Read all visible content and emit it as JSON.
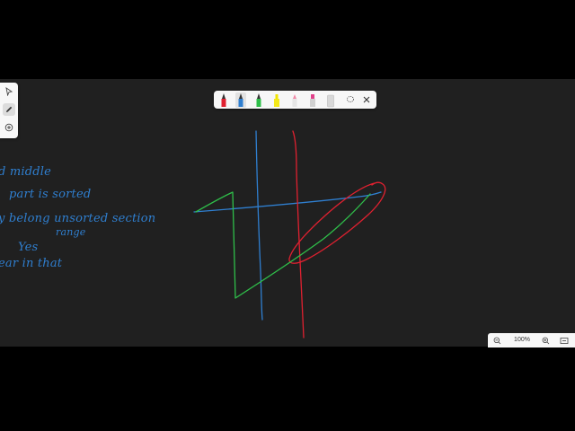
{
  "canvas": {
    "background": "#202020",
    "handwritten_notes": [
      "d middle",
      "part is sorted",
      "y belong unsorted section",
      "range",
      "Yes",
      "ear in that"
    ],
    "stroke_colors": {
      "blue": "#2f7fd0",
      "red": "#e02030",
      "green": "#2fbf4a"
    }
  },
  "left_toolbar": {
    "tools": [
      "select-icon",
      "pen-icon",
      "add-icon"
    ],
    "active_tool": "pen-icon"
  },
  "pen_toolbar": {
    "pens": [
      {
        "name": "red-pen",
        "color": "#e02030"
      },
      {
        "name": "blue-pen",
        "color": "#2f7fd0",
        "selected": true
      },
      {
        "name": "green-pen",
        "color": "#2fbf4a"
      },
      {
        "name": "yellow-highlighter",
        "color": "#f2e600"
      },
      {
        "name": "pink-pen",
        "color": "#f08aa8"
      },
      {
        "name": "magenta-highlighter",
        "color": "#e0408a"
      },
      {
        "name": "eraser",
        "color": "#d8d8d8"
      }
    ],
    "lasso_icon": "lasso-icon",
    "close_icon": "close-icon"
  },
  "zoom_bar": {
    "zoom_out_icon": "zoom-out-icon",
    "zoom_level": "100%",
    "zoom_in_icon": "zoom-in-icon",
    "fit_icon": "fit-to-screen-icon"
  }
}
